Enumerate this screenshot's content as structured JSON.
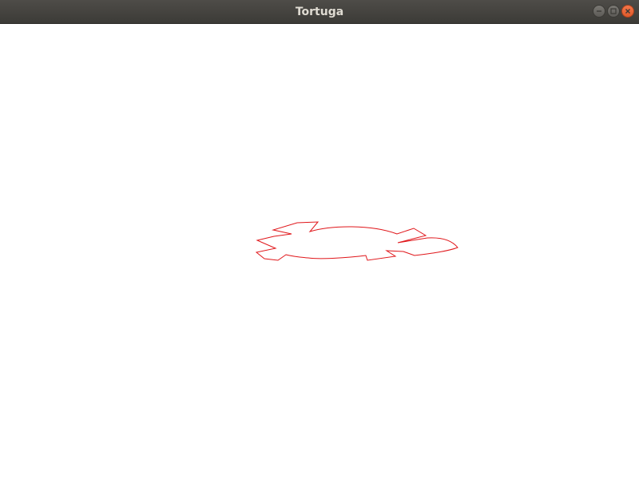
{
  "window": {
    "title": "Tortuga",
    "controls": {
      "minimize_icon": "minimize-icon",
      "maximize_icon": "maximize-icon",
      "close_icon": "close-icon"
    }
  },
  "canvas": {
    "background": "#ffffff",
    "drawing": {
      "shape": "turtle-outline",
      "stroke_color": "#e0161a"
    }
  }
}
